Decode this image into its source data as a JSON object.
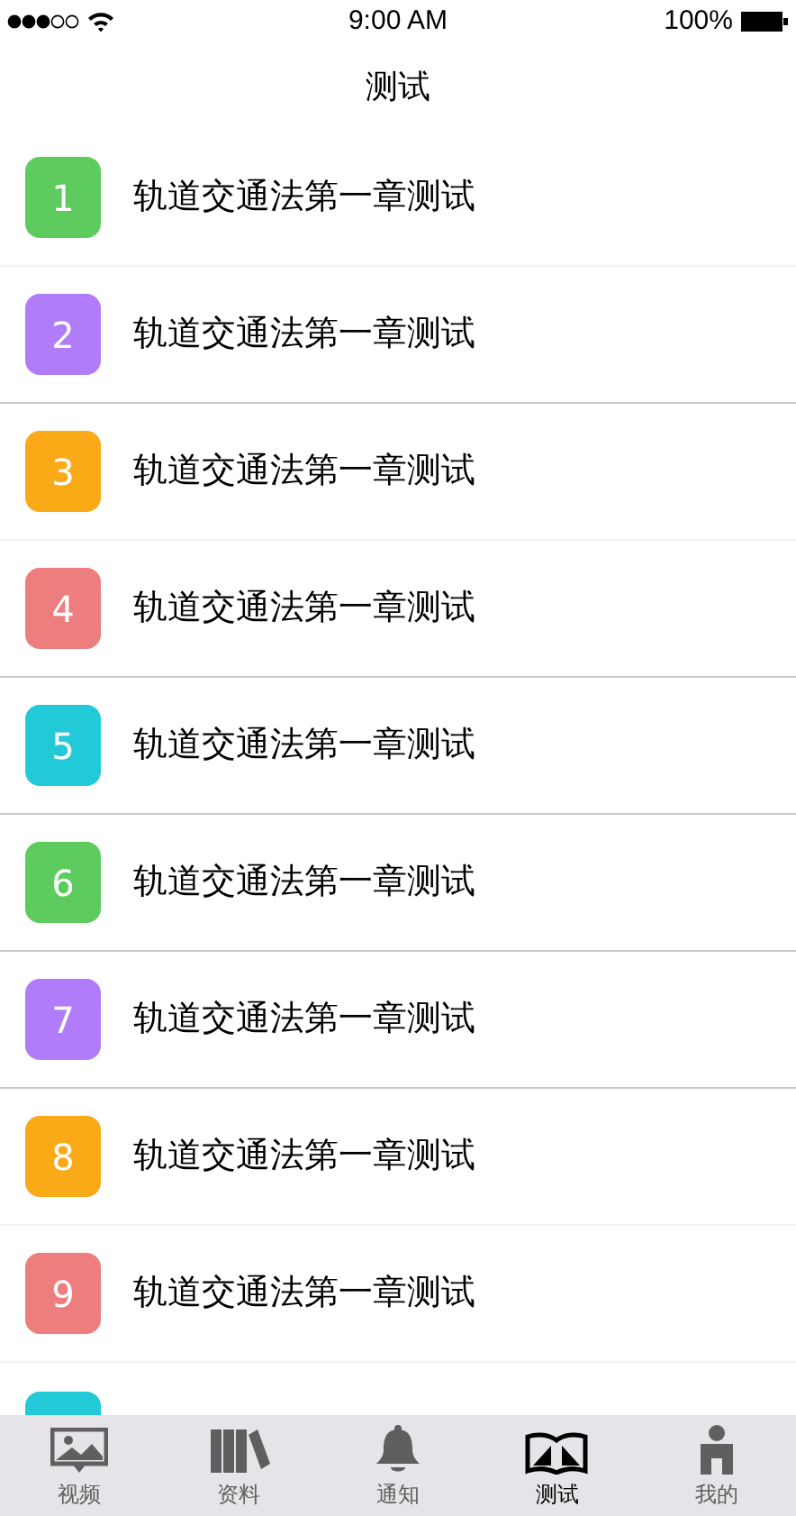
{
  "status_bar": {
    "time": "9:00 AM",
    "battery": "100%"
  },
  "header": {
    "title": "测试"
  },
  "tests": [
    {
      "number": "1",
      "title": "轨道交通法第一章测试",
      "color": "#5ecb5e",
      "divider": false
    },
    {
      "number": "2",
      "title": "轨道交通法第一章测试",
      "color": "#b07cf9",
      "divider": true
    },
    {
      "number": "3",
      "title": "轨道交通法第一章测试",
      "color": "#fbaa17",
      "divider": false
    },
    {
      "number": "4",
      "title": "轨道交通法第一章测试",
      "color": "#ee7d7d",
      "divider": true
    },
    {
      "number": "5",
      "title": "轨道交通法第一章测试",
      "color": "#22c9d6",
      "divider": true
    },
    {
      "number": "6",
      "title": "轨道交通法第一章测试",
      "color": "#5ecb5e",
      "divider": true
    },
    {
      "number": "7",
      "title": "轨道交通法第一章测试",
      "color": "#b07cf9",
      "divider": true
    },
    {
      "number": "8",
      "title": "轨道交通法第一章测试",
      "color": "#fbaa17",
      "divider": false
    },
    {
      "number": "9",
      "title": "轨道交通法第一章测试",
      "color": "#ee7d7d",
      "divider": false
    },
    {
      "color": "#22c9d6"
    }
  ],
  "tab_bar": [
    {
      "kind": "video",
      "label": "视频",
      "selected": false
    },
    {
      "kind": "books",
      "label": "资料",
      "selected": false
    },
    {
      "kind": "bell",
      "label": "通知",
      "selected": false
    },
    {
      "kind": "book",
      "label": "测试",
      "selected": true
    },
    {
      "kind": "person",
      "label": "我的",
      "selected": false
    }
  ]
}
